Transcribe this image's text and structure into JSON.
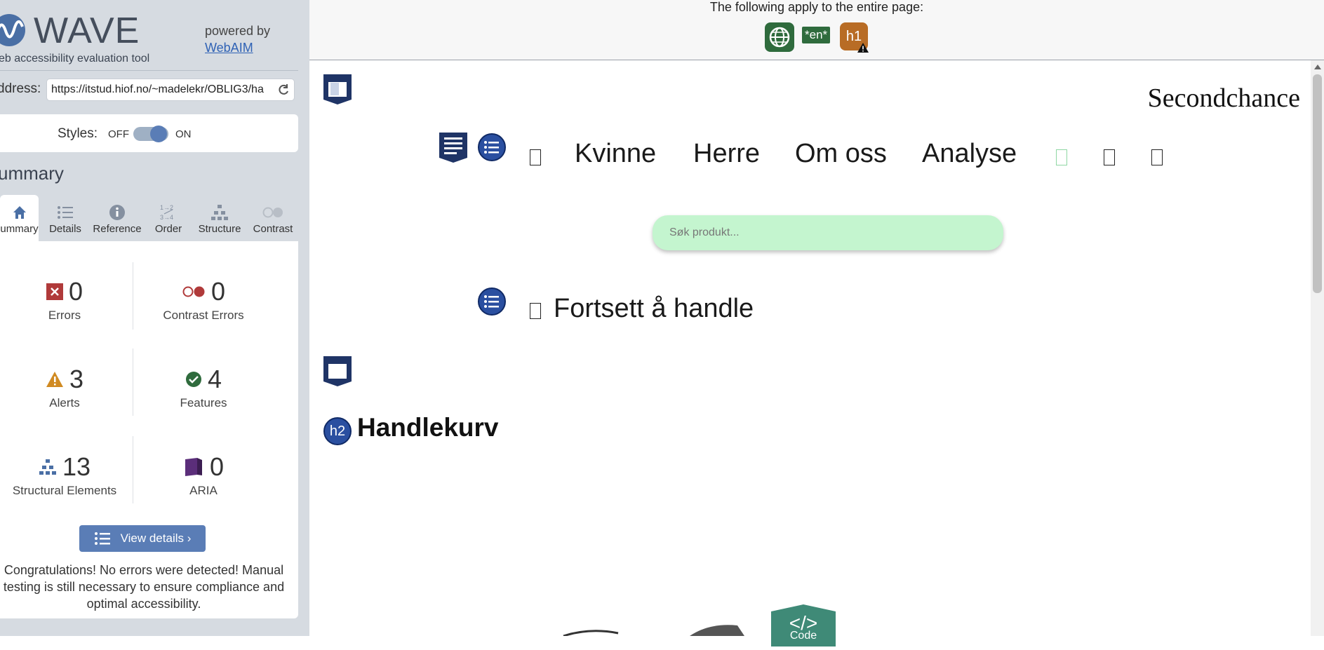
{
  "sidebar": {
    "logo_text": "WAVE",
    "logo_sub": "eb accessibility evaluation tool",
    "powered_by": "powered by",
    "webaim_link": "WebAIM",
    "address_label": "ddress:",
    "address_value": "https://itstud.hiof.no/~madelekr/OBLIG3/ha",
    "styles_label": "Styles:",
    "styles_off": "OFF",
    "styles_on": "ON",
    "summary_title": "ummary",
    "tabs": [
      {
        "label": "ummary",
        "icon": "home-icon"
      },
      {
        "label": "Details",
        "icon": "list-icon"
      },
      {
        "label": "Reference",
        "icon": "info-icon"
      },
      {
        "label": "Order",
        "icon": "order-icon"
      },
      {
        "label": "Structure",
        "icon": "structure-icon"
      },
      {
        "label": "Contrast",
        "icon": "contrast-icon"
      }
    ],
    "stats": {
      "errors": {
        "count": "0",
        "label": "Errors"
      },
      "contrast_errors": {
        "count": "0",
        "label": "Contrast Errors"
      },
      "alerts": {
        "count": "3",
        "label": "Alerts"
      },
      "features": {
        "count": "4",
        "label": "Features"
      },
      "structural": {
        "count": "13",
        "label": "Structural Elements"
      },
      "aria": {
        "count": "0",
        "label": "ARIA"
      }
    },
    "view_details": "View details ›",
    "congrats": "Congratulations! No errors were detected! Manual testing is still necessary to ensure compliance and optimal accessibility."
  },
  "page": {
    "topbar_text": "The following apply to the entire page:",
    "lang_badge": "*en*",
    "h1_badge": "h1",
    "site_title": "Secondchance",
    "nav": [
      "Kvinne",
      "Herre",
      "Om oss",
      "Analyse"
    ],
    "search_placeholder": "Søk produkt...",
    "continue_link": "Fortsett å handle",
    "h2_badge": "h2",
    "heading": "Handlekurv",
    "code_badge": "Code"
  },
  "colors": {
    "accent": "#5a7db6",
    "error": "#b03a3a",
    "alert": "#d08a22",
    "feature": "#2f6b3d",
    "search_bg": "#c4f5cf"
  }
}
